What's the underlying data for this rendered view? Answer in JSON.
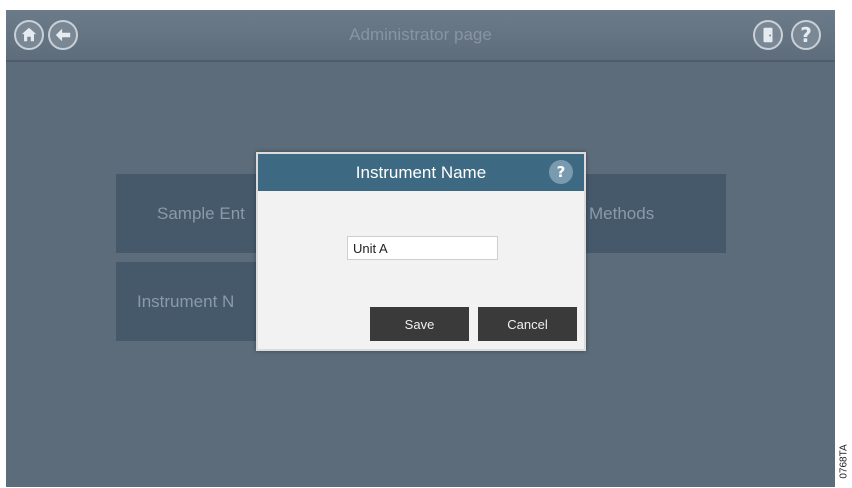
{
  "header": {
    "title": "Administrator page",
    "icons": {
      "home": "home-icon",
      "back": "back-arrow-icon",
      "exit": "door-exit-icon",
      "help": "help-icon"
    },
    "help_glyph": "?"
  },
  "tiles": {
    "sample_entry": "Sample Ent",
    "methods": "Methods",
    "instrument_name": "Instrument N"
  },
  "dialog": {
    "title": "Instrument Name",
    "help_glyph": "?",
    "input_value": "Unit A",
    "save_label": "Save",
    "cancel_label": "Cancel"
  },
  "figure_code": "0768TA",
  "colors": {
    "background": "#5d6c7a",
    "tile": "#45596b",
    "dialog_header": "#3d6a82",
    "dialog_body": "#f2f2f2",
    "button": "#3a3a3a"
  }
}
